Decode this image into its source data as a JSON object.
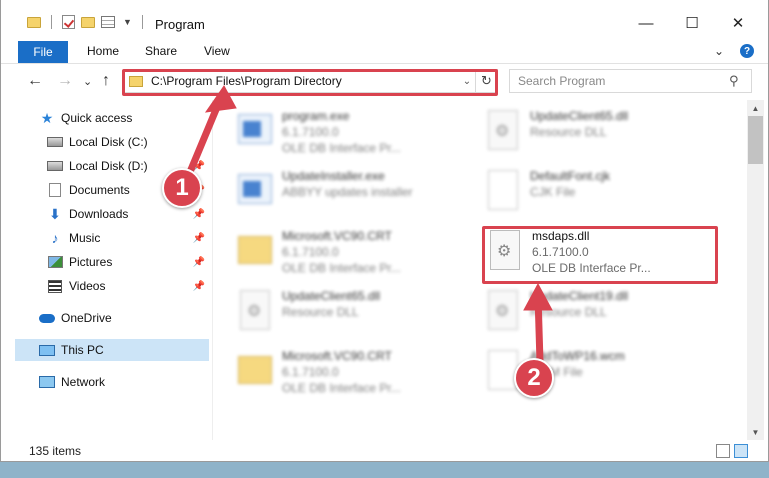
{
  "window": {
    "title": "Program",
    "controls": {
      "minimize": "—",
      "maximize": "☐",
      "close": "✕"
    }
  },
  "ribbon": {
    "tabs": [
      "File",
      "Home",
      "Share",
      "View"
    ],
    "expand_icon": "chevron-down-icon",
    "help_label": "?"
  },
  "navigation": {
    "back": "←",
    "forward": "→",
    "recent": "⌄",
    "up": "↑",
    "address": "C:\\Program Files\\Program Directory",
    "refresh": "↻",
    "search_placeholder": "Search Program",
    "search_icon_glyph": "⚲"
  },
  "sidebar": {
    "items": [
      {
        "label": "Quick access",
        "icon": "star-icon"
      },
      {
        "label": "Local Disk (C:)",
        "icon": "disk-icon"
      },
      {
        "label": "Local Disk (D:)",
        "icon": "disk-icon"
      },
      {
        "label": "Documents",
        "icon": "documents-icon"
      },
      {
        "label": "Downloads",
        "icon": "download-icon"
      },
      {
        "label": "Music",
        "icon": "music-icon"
      },
      {
        "label": "Pictures",
        "icon": "pictures-icon"
      },
      {
        "label": "Videos",
        "icon": "videos-icon"
      },
      {
        "label": "OneDrive",
        "icon": "cloud-icon"
      },
      {
        "label": "This PC",
        "icon": "computer-icon",
        "selected": true
      },
      {
        "label": "Network",
        "icon": "network-icon"
      }
    ]
  },
  "files": [
    {
      "name": "program.exe",
      "line2": "6.1.7100.0",
      "line3": "OLE DB Interface Pr...",
      "icon": "exe-icon"
    },
    {
      "name": "UpdateClient65.dll",
      "line2": "Resource DLL",
      "line3": "",
      "icon": "dll-icon"
    },
    {
      "name": "UpdateInstaller.exe",
      "line2": "ABBYY updates installer",
      "line3": "",
      "icon": "exe-icon"
    },
    {
      "name": "DefaultFont.cjk",
      "line2": "CJK File",
      "line3": "",
      "icon": "file-icon"
    },
    {
      "name": "Microsoft.VC90.CRT",
      "line2": "6.1.7100.0",
      "line3": "OLE DB Interface Pr...",
      "icon": "folder-icon"
    },
    {
      "name": "msdaps.dll",
      "line2": "6.1.7100.0",
      "line3": "OLE DB Interface Pr...",
      "icon": "dll-icon"
    },
    {
      "name": "UpdateClient65.dll",
      "line2": "Resource DLL",
      "line3": "",
      "icon": "dll-icon"
    },
    {
      "name": "UpdateClient19.dll",
      "line2": "Resource DLL",
      "line3": "",
      "icon": "dll-icon"
    },
    {
      "name": "Microsoft.VC90.CRT",
      "line2": "6.1.7100.0",
      "line3": "OLE DB Interface Pr...",
      "icon": "folder-icon"
    },
    {
      "name": "AddToWP16.wcm",
      "line2": "WCM File",
      "line3": "",
      "icon": "file-icon"
    }
  ],
  "status": {
    "item_count": "135 items"
  },
  "callouts": [
    "1",
    "2"
  ],
  "colors": {
    "accent": "#1a6ec7",
    "highlight": "#d9434f",
    "selected": "#cce4f7"
  }
}
